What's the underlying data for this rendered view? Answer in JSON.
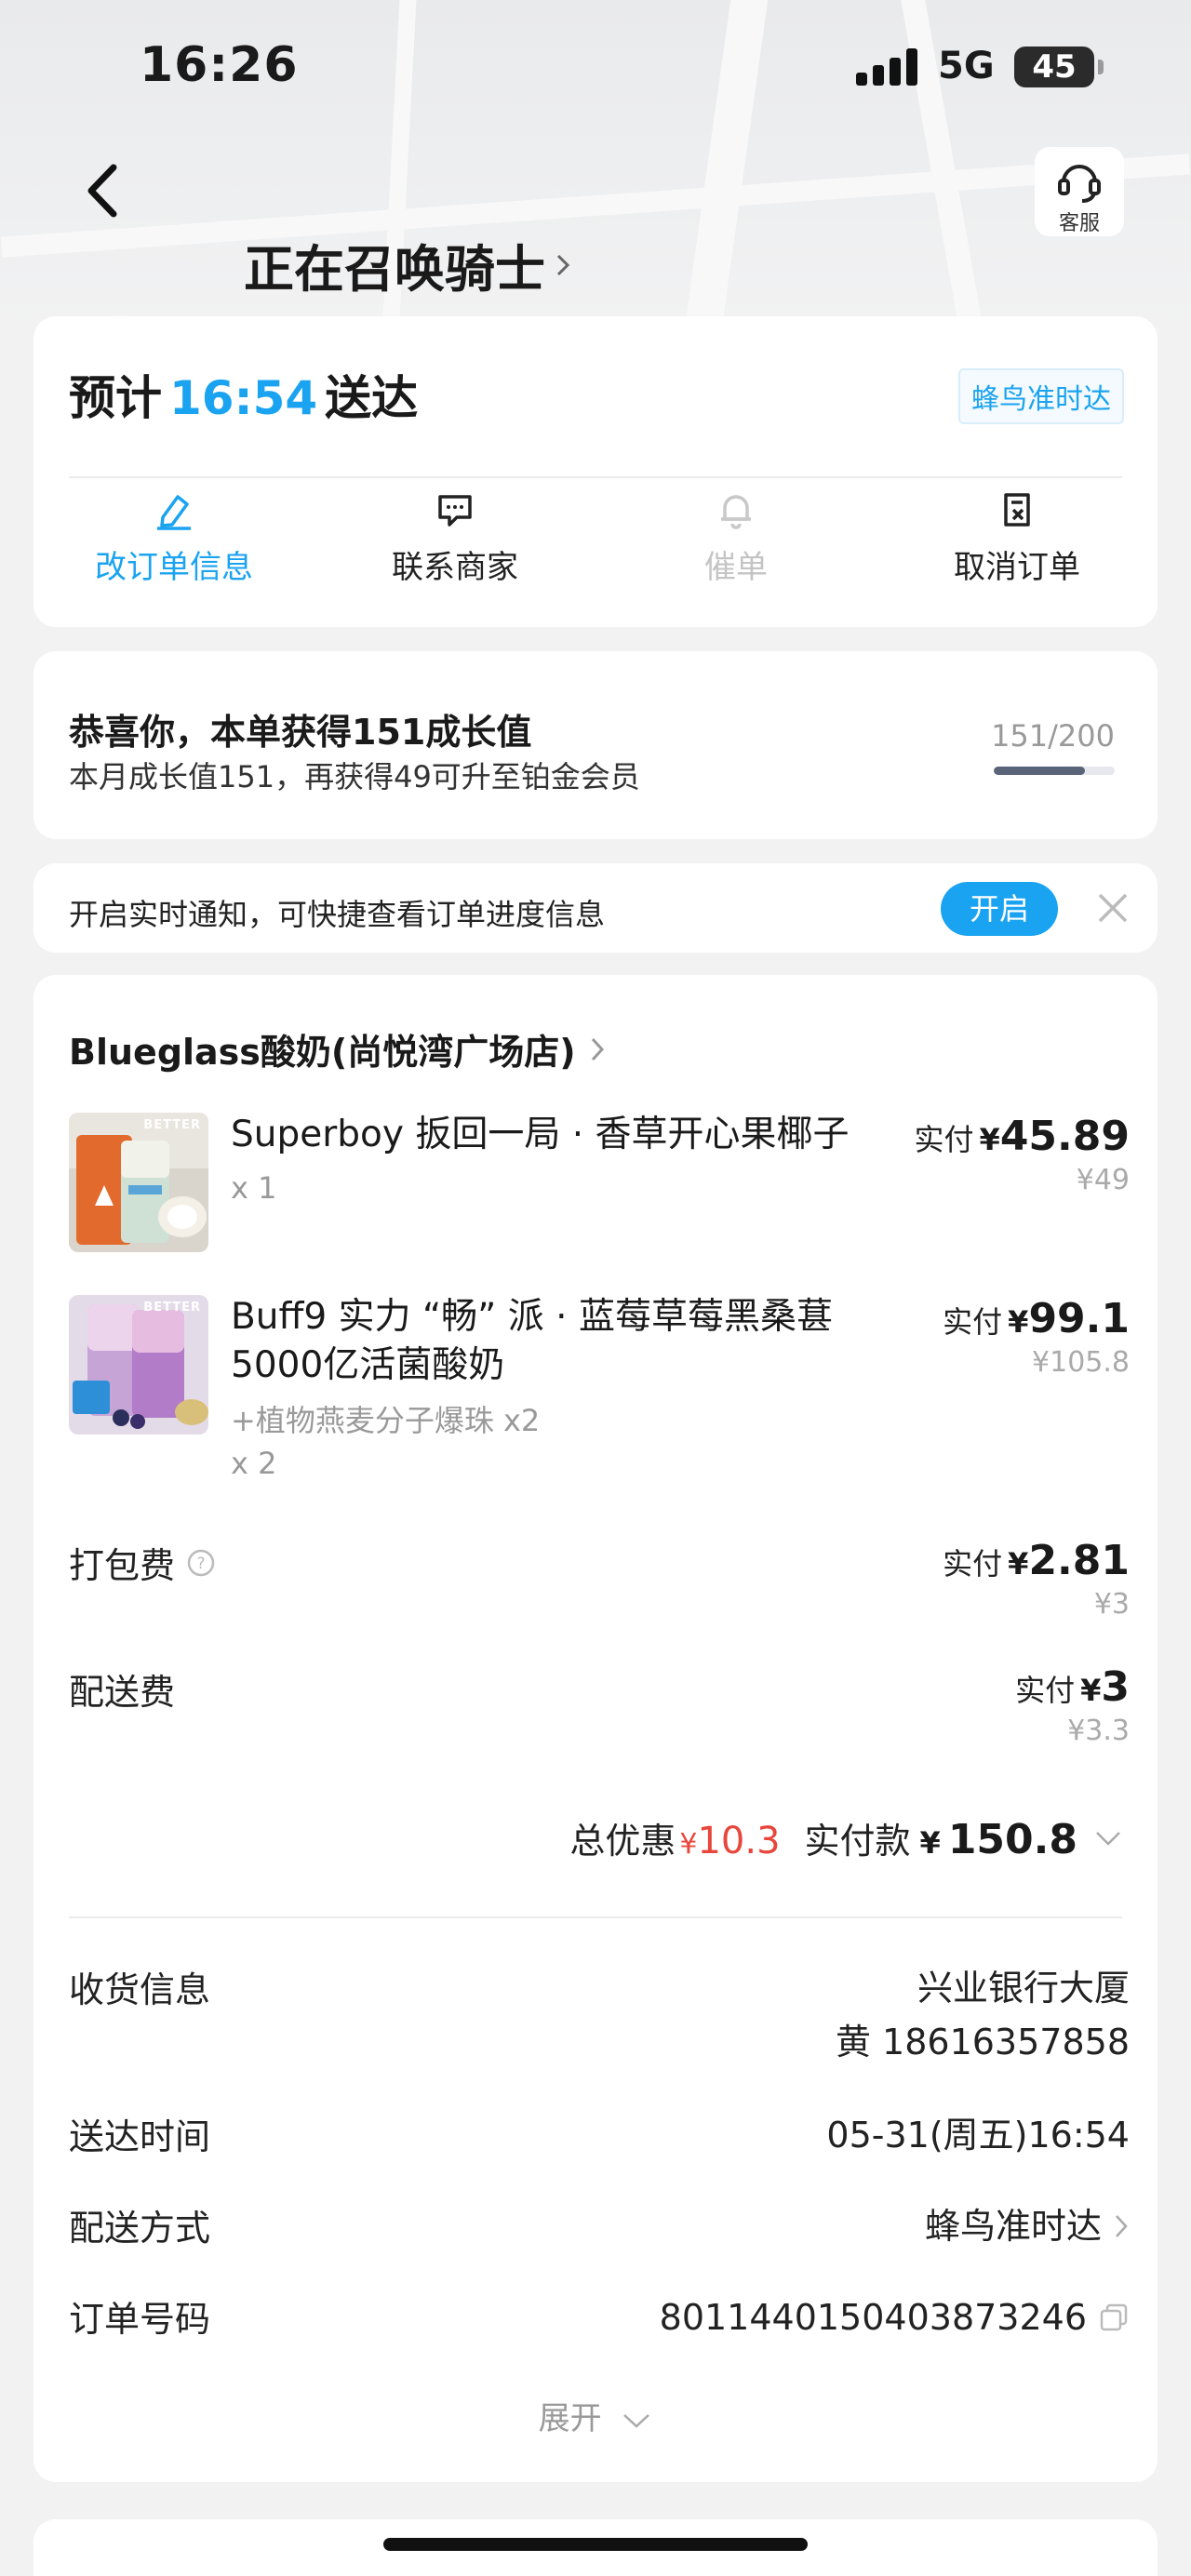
{
  "status_bar": {
    "time": "16:26",
    "network": "5G",
    "battery": "45"
  },
  "header": {
    "title": "正在召唤骑士",
    "service_label": "客服"
  },
  "delivery": {
    "eta_prefix": "预计",
    "eta_time": "16:54",
    "eta_suffix": "送达",
    "badge": "蜂鸟准时达",
    "actions": [
      {
        "label": "改订单信息",
        "icon": "edit-icon",
        "state": "active"
      },
      {
        "label": "联系商家",
        "icon": "chat-icon",
        "state": "normal"
      },
      {
        "label": "催单",
        "icon": "bell-icon",
        "state": "disabled"
      },
      {
        "label": "取消订单",
        "icon": "cancel-order-icon",
        "state": "normal"
      }
    ]
  },
  "growth": {
    "title": "恭喜你，本单获得151成长值",
    "subtitle": "本月成长值151，再获得49可升至铂金会员",
    "count": "151/200",
    "progress": 0.755
  },
  "notify": {
    "text": "开启实时通知，可快捷查看订单进度信息",
    "button": "开启"
  },
  "order": {
    "shop_name": "Blueglass酸奶(尚悦湾广场店)",
    "items": [
      {
        "name": "Superboy 扳回一局 · 香草开心果椰子",
        "qty": "x 1",
        "extra": "",
        "paid_label": "实付",
        "currency": "¥",
        "paid": "45.89",
        "original": "¥49"
      },
      {
        "name": "Buff9 实力 “畅” 派 · 蓝莓草莓黑桑葚 5000亿活菌酸奶",
        "qty": "x 2",
        "extra": "+植物燕麦分子爆珠 x2",
        "paid_label": "实付",
        "currency": "¥",
        "paid": "99.1",
        "original": "¥105.8"
      }
    ],
    "thumb_brand": "BETTER",
    "fees": [
      {
        "label": "打包费",
        "paid_label": "实付",
        "currency": "¥",
        "paid": "2.81",
        "original": "¥3"
      },
      {
        "label": "配送费",
        "paid_label": "实付",
        "currency": "¥",
        "paid": "3",
        "original": "¥3.3"
      }
    ],
    "total": {
      "discount_label": "总优惠",
      "discount_currency": "¥",
      "discount": "10.3",
      "paid_label": "实付款",
      "paid_currency": "¥",
      "paid": "150.8"
    },
    "info": {
      "receiver_label": "收货信息",
      "receiver_address": "兴业银行大厦",
      "receiver_contact": "黄 18616357858",
      "time_label": "送达时间",
      "time_value": "05-31(周五)16:54",
      "method_label": "配送方式",
      "method_value": "蜂鸟准时达",
      "order_no_label": "订单号码",
      "order_no": "8011440150403873246"
    },
    "expand_label": "展开"
  },
  "colors": {
    "accent": "#1aa3f0",
    "discount": "#e8463b"
  }
}
